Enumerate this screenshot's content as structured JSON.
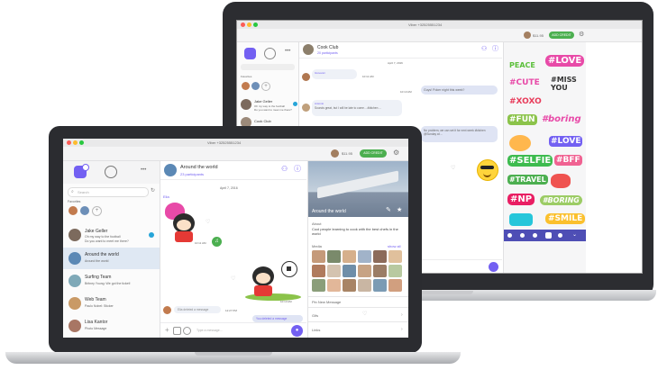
{
  "back_app": {
    "window_title": "Viber +32525551234",
    "balance": "$11.95",
    "add_credit": "ADD CREDIT",
    "chat_name": "Cook Club",
    "participants": "20 participants",
    "date_divider": "April 7, 2016",
    "favorites_label": "Favorites",
    "contacts": [
      {
        "name": "Jake Geller",
        "preview": "Oh my way to the football",
        "preview2": "Do you want to meet me there?"
      },
      {
        "name": "Cook Club",
        "preview": ""
      }
    ],
    "messages": [
      {
        "sender": "Giovanni",
        "text": "",
        "time": "10:11 AM"
      },
      {
        "sender": "",
        "text": "Guys! Poker night this week?",
        "time": "10:13 AM"
      },
      {
        "sender": "Antonio",
        "text": "Sounds great, but I will be late to come... #kitchen ...",
        "time": "10:15 AM"
      },
      {
        "sender": "",
        "text": "No problem, we can set it for next week #kitchen @Sunday at ...",
        "time": "10:17 AM"
      }
    ],
    "sticker_texts": [
      "PEACE",
      "#LOVE",
      "#CUTE",
      "#MISS YOU",
      "#XOXO",
      "#FUN",
      "#boring",
      "#LOVE",
      "#SELFIE",
      "#BFF",
      "#TRAVEL",
      "#NP",
      "#BORING",
      "#SMILE"
    ],
    "input_placeholder": "Type a message..."
  },
  "front_app": {
    "window_title": "Viber +32525551234",
    "balance": "$11.95",
    "add_credit": "ADD CREDIT",
    "search_placeholder": "Search",
    "favorites_label": "Favorites",
    "chat_name": "Around the world",
    "participants": "23 participants",
    "date_divider": "April 7, 2016",
    "first_sender": "Elia",
    "info_group_name": "Around the world",
    "about_label": "About",
    "about_text": "Cool people learning to cook with the best chefs in the world",
    "media_label": "Media",
    "show_all": "show all",
    "pin_label": "Pin New Message",
    "gifs_label": "Gifs",
    "links_label": "Links",
    "deleted_message_left": "Elia deleted a message",
    "deleted_message_right": "You deleted a message",
    "input_placeholder": "Type a message...",
    "contacts": [
      {
        "name": "Jake Geller",
        "preview": "Oh my way to the football",
        "preview2": "Do you want to meet me there?"
      },
      {
        "name": "Around the world",
        "preview": "Around the world"
      },
      {
        "name": "Surfing Team",
        "preview": "Britney Young: We got the ticket!"
      },
      {
        "name": "Web Team",
        "preview": "Paulo Nobel: Sticker"
      },
      {
        "name": "Lisa Kantor",
        "preview": "Photo Message"
      }
    ],
    "times": [
      "10:11 AM",
      "10:13 AM",
      "12:27 PM"
    ]
  },
  "colors": {
    "viber_purple": "#7360f2",
    "add_credit_green": "#4caf50",
    "sticker_pink": "#e84aa8",
    "sticker_green": "#5bbf3a"
  }
}
